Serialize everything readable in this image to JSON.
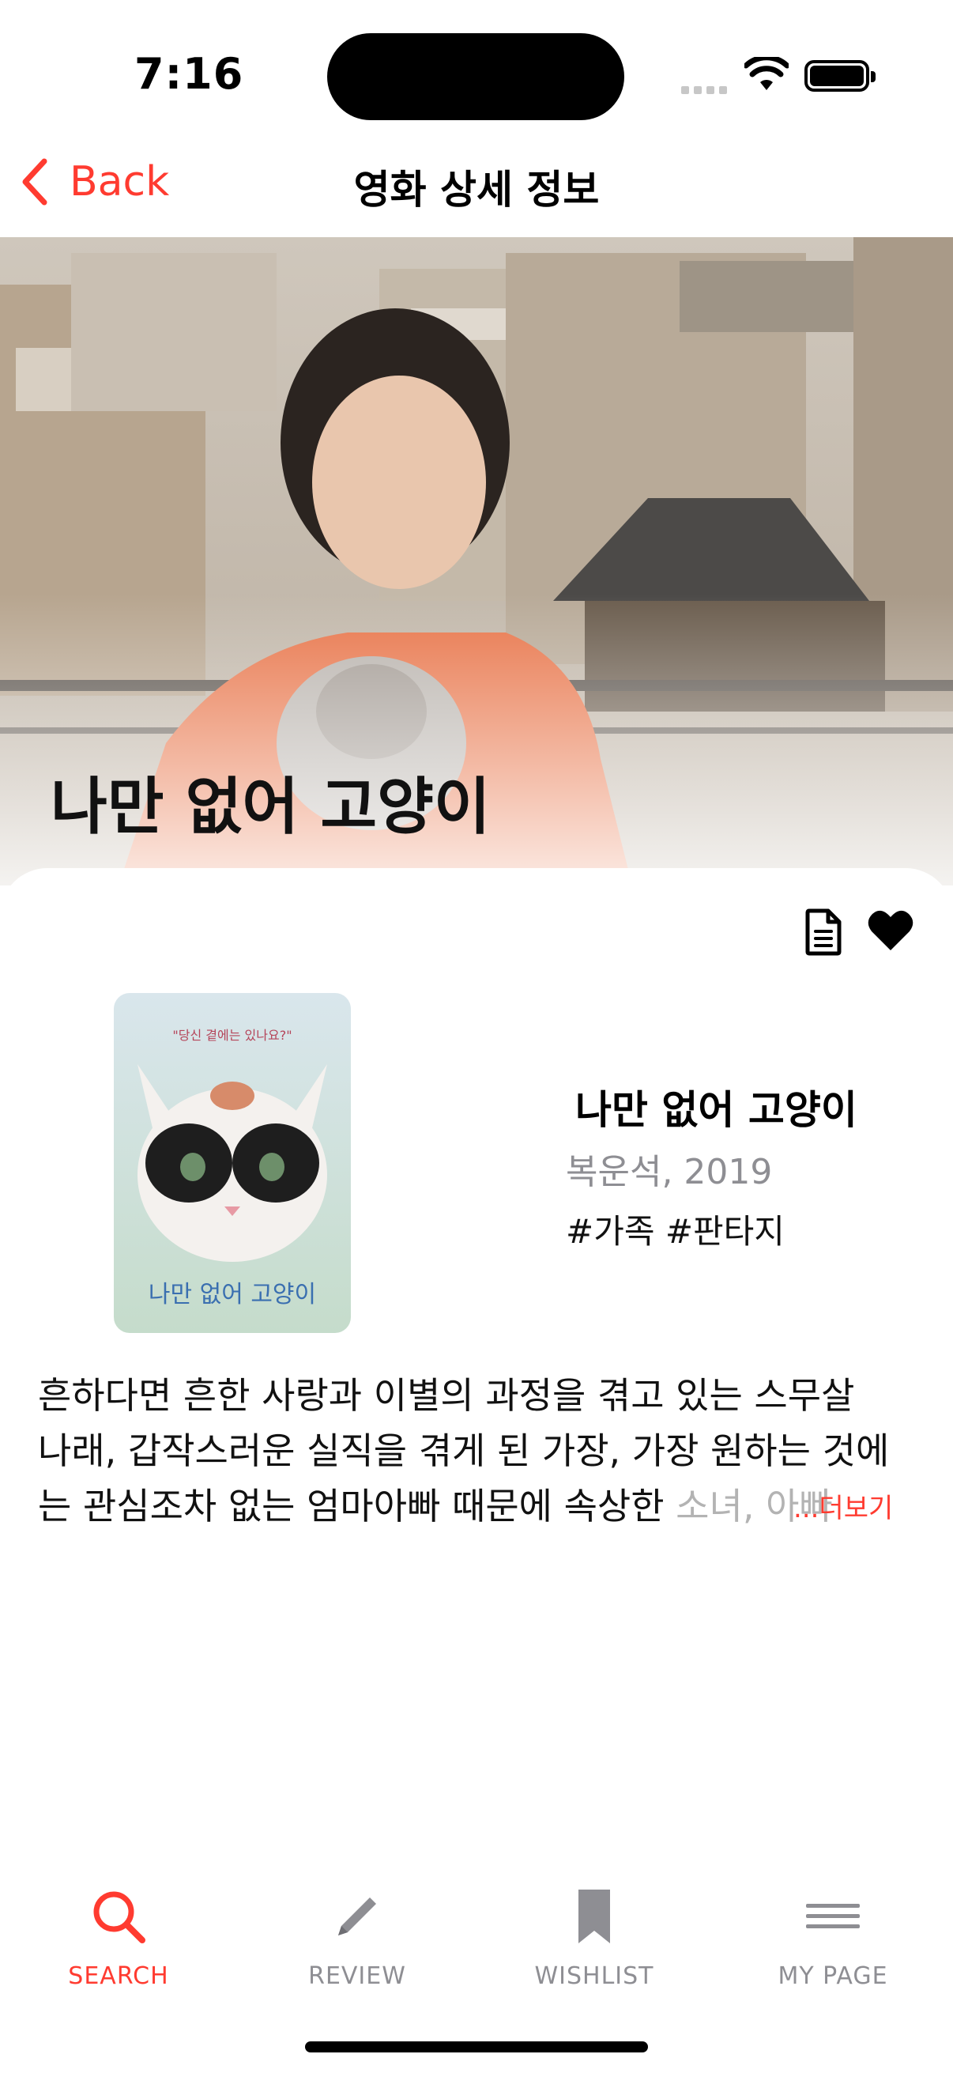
{
  "status_bar": {
    "time": "7:16"
  },
  "nav": {
    "back_label": "Back",
    "title": "영화 상세 정보"
  },
  "hero": {
    "title": "나만 없어 고양이"
  },
  "poster": {
    "title": "나만 없어 고양이",
    "tagline": "\"당신 곁에는 있나요?\""
  },
  "movie": {
    "title": "나만 없어 고양이",
    "director_year": "복운석, 2019",
    "genres": "#가족 #판타지"
  },
  "synopsis": {
    "line1": "흔하다면 흔한 사랑과 이별의 과정을 겪고 있는 스무살",
    "line2": "나래, 갑작스러운 실직을 겪게 된 가장, 가장 원하는 것에",
    "line3_main": "는 관심조차 없는 엄마아빠 때문에 속상한",
    "line3_fade": " 소녀, 아빠",
    "more_label": "...더보기"
  },
  "tabs": [
    {
      "label": "SEARCH",
      "icon": "magnifier-icon",
      "active": true
    },
    {
      "label": "REVIEW",
      "icon": "pencil-icon",
      "active": false
    },
    {
      "label": "WISHLIST",
      "icon": "bookmark-icon",
      "active": false
    },
    {
      "label": "MY PAGE",
      "icon": "menu-lines-icon",
      "active": false
    }
  ],
  "colors": {
    "accent": "#ff3b30",
    "inactive": "#8e8e93"
  }
}
